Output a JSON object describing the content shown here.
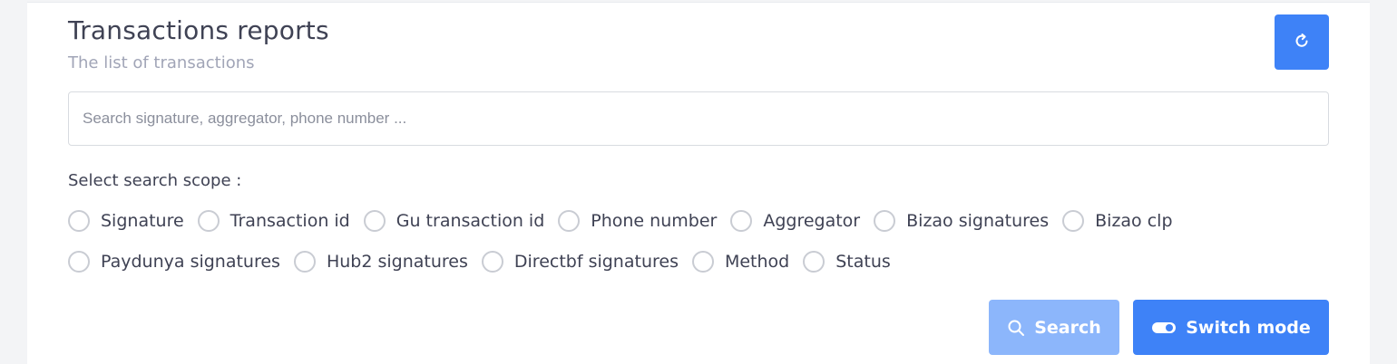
{
  "header": {
    "title": "Transactions reports",
    "subtitle": "The list of transactions",
    "refresh_icon": "refresh-icon"
  },
  "search": {
    "placeholder": "Search signature, aggregator, phone number ...",
    "value": ""
  },
  "scope": {
    "label": "Select search scope :",
    "row1": [
      "Signature",
      "Transaction id",
      "Gu transaction id",
      "Phone number",
      "Aggregator",
      "Bizao signatures",
      "Bizao clp"
    ],
    "row2": [
      "Paydunya signatures",
      "Hub2 signatures",
      "Directbf signatures",
      "Method",
      "Status"
    ]
  },
  "actions": {
    "search_label": "Search",
    "search_icon": "magnifier-icon",
    "switch_label": "Switch mode",
    "switch_icon": "toggle-icon"
  },
  "colors": {
    "primary": "#3e82f7",
    "primary_light": "#8cb6fb",
    "text": "#3f4254",
    "muted": "#a1a5b7"
  }
}
